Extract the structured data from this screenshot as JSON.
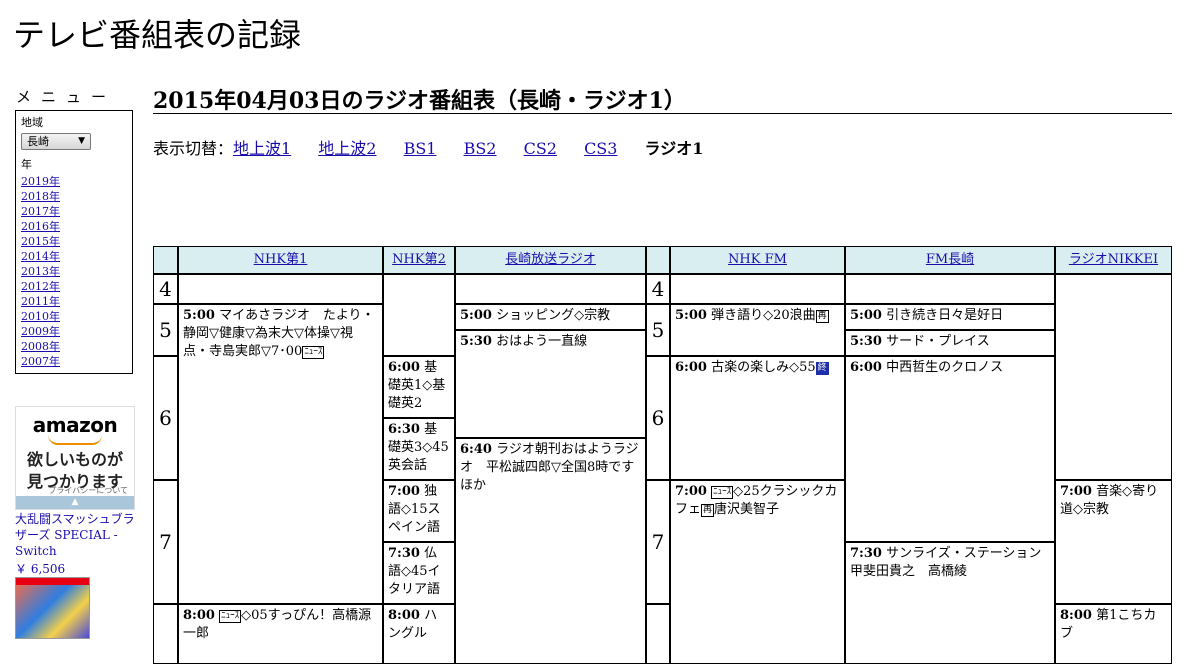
{
  "site": {
    "title": "テレビ番組表の記録"
  },
  "sidebar": {
    "menu_heading": "メニュー",
    "region_label": "地域",
    "region_selected": "長崎",
    "year_label": "年",
    "years": [
      "2019年",
      "2018年",
      "2017年",
      "2016年",
      "2015年",
      "2014年",
      "2013年",
      "2012年",
      "2011年",
      "2010年",
      "2009年",
      "2008年",
      "2007年"
    ]
  },
  "ad": {
    "logo": "amazon",
    "tagline_1": "欲しいものが",
    "tagline_2": "見つかります",
    "privacy": "プライバシーについて",
    "product_name": "大乱闘スマッシュブラザーズ SPECIAL - Switch",
    "product_price": "￥ 6,506"
  },
  "page": {
    "heading": "2015年04月03日のラジオ番組表（長崎・ラジオ1）",
    "switch_label": "表示切替：",
    "switch_links": [
      "地上波1",
      "地上波2",
      "BS1",
      "BS2",
      "CS2",
      "CS3"
    ],
    "switch_current": "ラジオ1"
  },
  "grid": {
    "channels": [
      "NHK第1",
      "NHK第2",
      "長崎放送ラジオ",
      "NHK FM",
      "FM長崎",
      "ラジオNIKKEI"
    ],
    "hours": [
      "4",
      "5",
      "6",
      "7",
      "4",
      "5",
      "6",
      "7"
    ],
    "programs": {
      "nhk1_0500": {
        "time": "5:00",
        "title": "マイあさラジオ　たより・静岡▽健康▽為末大▽体操▽視点・寺島実郎▽7･00"
      },
      "nhk1_0800": {
        "time": "8:00",
        "title": "◇05すっぴん！高橋源一郎"
      },
      "nhk2_0600": {
        "time": "6:00",
        "title": "基礎英1◇基礎英2"
      },
      "nhk2_0630": {
        "time": "6:30",
        "title": "基礎英3◇45英会話"
      },
      "nhk2_0700": {
        "time": "7:00",
        "title": "独語◇15スペイン語"
      },
      "nhk2_0730": {
        "time": "7:30",
        "title": "仏語◇45イタリア語"
      },
      "nhk2_0800": {
        "time": "8:00",
        "title": "ハングル"
      },
      "nbc_0500": {
        "time": "5:00",
        "title": "ショッピング◇宗教"
      },
      "nbc_0530": {
        "time": "5:30",
        "title": "おはよう一直線"
      },
      "nbc_0640": {
        "time": "6:40",
        "title": "ラジオ朝刊おはようラジオ　平松誠四郎▽全国8時です ほか"
      },
      "fm_0500": {
        "time": "5:00",
        "title": "弾き語り◇20浪曲"
      },
      "fm_0600": {
        "time": "6:00",
        "title": "古楽の楽しみ◇55"
      },
      "fm_0700": {
        "time": "7:00",
        "title": "◇25クラシックカフェ",
        "title_2": "唐沢美智子"
      },
      "fmn_0500": {
        "time": "5:00",
        "title": "引き続き日々是好日"
      },
      "fmn_0530": {
        "time": "5:30",
        "title": "サード・プレイス"
      },
      "fmn_0600": {
        "time": "6:00",
        "title": "中西哲生のクロノス"
      },
      "fmn_0730": {
        "time": "7:30",
        "title": "サンライズ・ステーション甲斐田貴之　高橋綾"
      },
      "nikkei_0700": {
        "time": "7:00",
        "title": "音楽◇寄り道◇宗教"
      },
      "nikkei_0800": {
        "time": "8:00",
        "title": "第1こちカブ"
      }
    },
    "glyphs": {
      "news": "ﾆｭｰｽ",
      "rebroadcast": "再",
      "end": "終"
    }
  }
}
